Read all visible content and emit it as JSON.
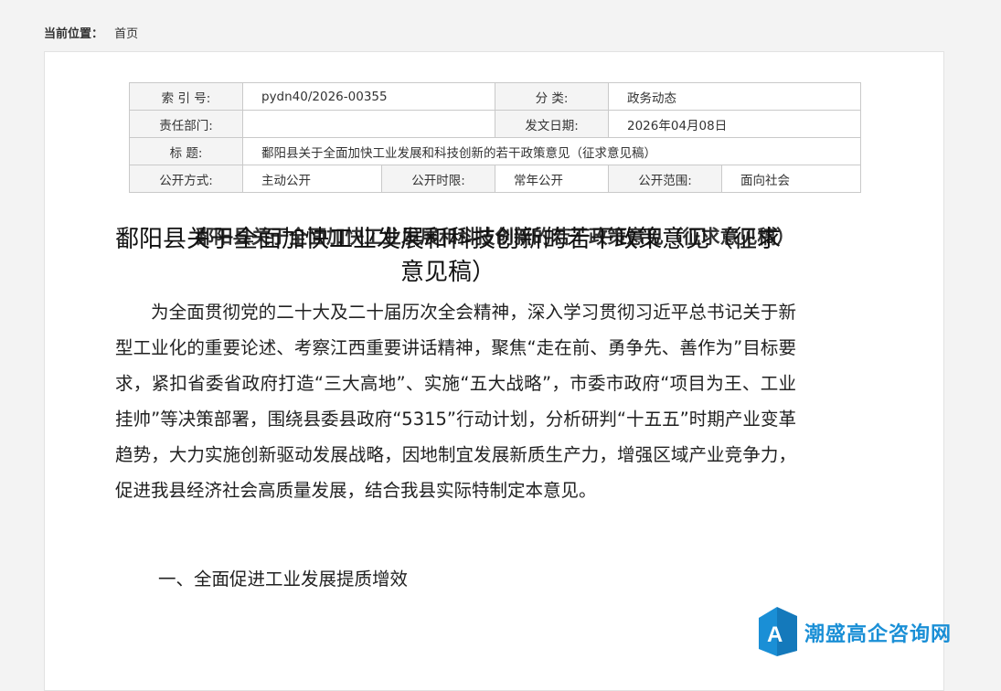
{
  "breadcrumb": {
    "label": "当前位置：",
    "home": "首页"
  },
  "meta": {
    "index_label": "索 引 号:",
    "index_value": "pydn40/2026-00355",
    "category_label": "分 类:",
    "category_value": "政务动态",
    "department_label": "责任部门:",
    "department_value": "",
    "date_label": "发文日期:",
    "date_value": "2026年04月08日",
    "title_label": "标 题:",
    "title_value": "鄱阳县关于全面加快工业发展和科技创新的若干政策意见（征求意见稿）",
    "disclosure_label": "公开方式:",
    "disclosure_value": "主动公开",
    "period_label": "公开时限:",
    "period_value": "常年公开",
    "scope_label": "公开范围:",
    "scope_value": "面向社会"
  },
  "doc_title": "鄱阳县关于全面加快工业发展和科技创新的若干政策意见（征求意见稿）",
  "body": {
    "title": "鄱阳县关于全面加快工业发展和科技创新的若干政策意见（征求意见稿）",
    "paragraph": "为全面贯彻党的二十大及二十届历次全会精神，深入学习贯彻习近平总书记关于新型工业化的重要论述、考察江西重要讲话精神，聚焦“走在前、勇争先、善作为”目标要求，紧扣省委省政府打造“三大高地”、实施“五大战略”，市委市政府“项目为王、工业挂帅”等决策部署，围绕县委县政府“5315”行动计划，分析研判“十五五”时期产业变革趋势，大力实施创新驱动发展战略，因地制宜发展新质生产力，增强区域产业竞争力，促进我县经济社会高质量发展，结合我县实际特制定本意见。",
    "section_1": "一、全面促进工业发展提质增效"
  },
  "watermark": {
    "text": "潮盛高企咨询网",
    "color": "#1a8fd6"
  }
}
